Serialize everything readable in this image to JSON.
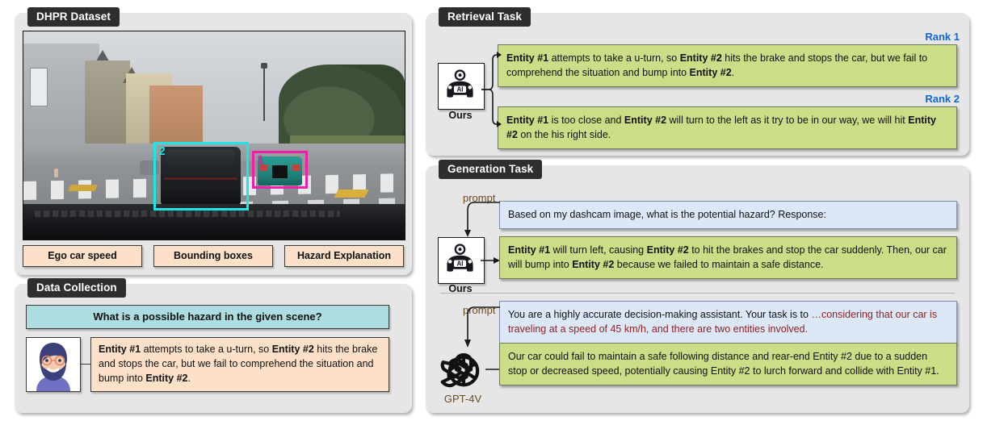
{
  "panels": {
    "dhpr": {
      "title": "DHPR Dataset"
    },
    "data_collection": {
      "title": "Data Collection"
    },
    "retrieval": {
      "title": "Retrieval Task"
    },
    "generation": {
      "title": "Generation Task"
    }
  },
  "dhpr": {
    "bbox_labels": {
      "entity1": "1",
      "entity2": "2"
    },
    "bbox_colors": {
      "entity1": "#f21fa6",
      "entity2": "#1fe5e5"
    },
    "tags": [
      "Ego car speed",
      "Bounding boxes",
      "Hazard Explanation"
    ]
  },
  "data_collection": {
    "question": "What is a possible hazard in the given scene?",
    "annotator_icon": "person-avatar-icon",
    "answer": {
      "p1": "Entity #1",
      "t1": " attempts to take a u-turn, so ",
      "p2": "Entity #2",
      "t2": " hits the brake and stops the car, but we fail to comprehend the situation and bump into ",
      "p3": "Entity #2",
      "t3": "."
    }
  },
  "retrieval": {
    "agent_label": "Ours",
    "agent_icon": "ai-car-icon",
    "rank1_label": "Rank 1",
    "rank2_label": "Rank 2",
    "rank1": {
      "p1": "Entity #1",
      "t1": " attempts to take a u-turn, so ",
      "p2": "Entity #2",
      "t2": " hits the brake and stops the car, but we fail to comprehend the situation and bump into ",
      "p3": "Entity #2",
      "t3": "."
    },
    "rank2": {
      "p1": "Entity #1",
      "t1": " is too close and ",
      "p2": "Entity #2",
      "t2": " will turn to the left as it try to be in our way, we will hit  ",
      "p3": "Entity #2",
      "t3": " on the his right side."
    }
  },
  "generation": {
    "ours": {
      "prompt_label": "prompt",
      "agent_label": "Ours",
      "agent_icon": "ai-car-icon",
      "prompt_text": "Based on my dashcam image, what is the potential hazard? Response:",
      "answer": {
        "p1": "Entity #1",
        "t1": " will turn left, causing ",
        "p2": "Entity #2",
        "t2": " to hit the brakes and stop the car suddenly. Then, our car will bump into ",
        "p3": "Entity #2",
        "t3": " because we failed to maintain a safe distance."
      }
    },
    "gpt4v": {
      "prompt_label": "prompt",
      "agent_label": "GPT-4V",
      "agent_icon": "openai-logo-icon",
      "prompt_black": "You are a highly accurate decision-making assistant. Your task is to ",
      "prompt_red": "…considering that our car is traveling at a speed of 45 km/h, and there are two entities involved.",
      "answer_text": "Our car could fail to maintain a safe following distance and rear-end Entity #2 due to a sudden stop or decreased speed, potentially causing Entity #2 to lurch forward and collide with Entity #1."
    }
  },
  "colors": {
    "panel_bg": "#e6e6e6",
    "title_bg": "#2e2e2e",
    "green": "#ccdd88",
    "blue": "#dce7f7",
    "peach": "#fde0c8",
    "cyan": "#addde0",
    "rank": "#1166dd",
    "red_text": "#8c1f1f",
    "prompt_label": "#6b4a1e"
  }
}
